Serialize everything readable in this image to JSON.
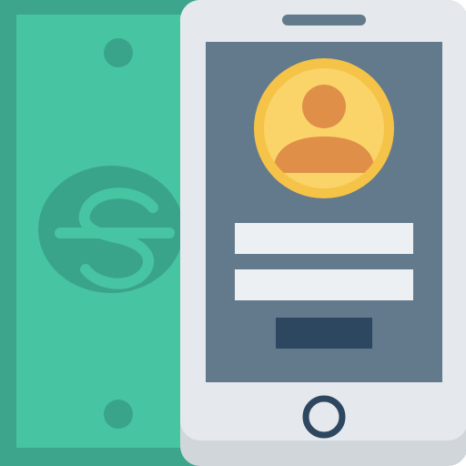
{
  "illustration": {
    "subject": "mobile-payment",
    "banknote": {
      "symbol": "$",
      "colors": {
        "body": "#47c4a1",
        "border": "#3ca58c",
        "ornament": "#3aa48b"
      }
    },
    "phone": {
      "colors": {
        "body": "#e5e9ed",
        "body_shadow": "#d1d6da",
        "screen": "#627a8c",
        "speaker": "#627a8c",
        "home_button": "#2e4760"
      },
      "profile": {
        "icon": "user-avatar-icon",
        "colors": {
          "ring": "#f4c348",
          "face": "#fad468",
          "person": "#e08f48"
        }
      },
      "form": {
        "fields": [
          {
            "icon": "text-field",
            "color": "#ecf0f3"
          },
          {
            "icon": "text-field",
            "color": "#ecf0f3"
          }
        ],
        "submit": {
          "icon": "submit-button",
          "color": "#2e4760"
        }
      }
    }
  }
}
